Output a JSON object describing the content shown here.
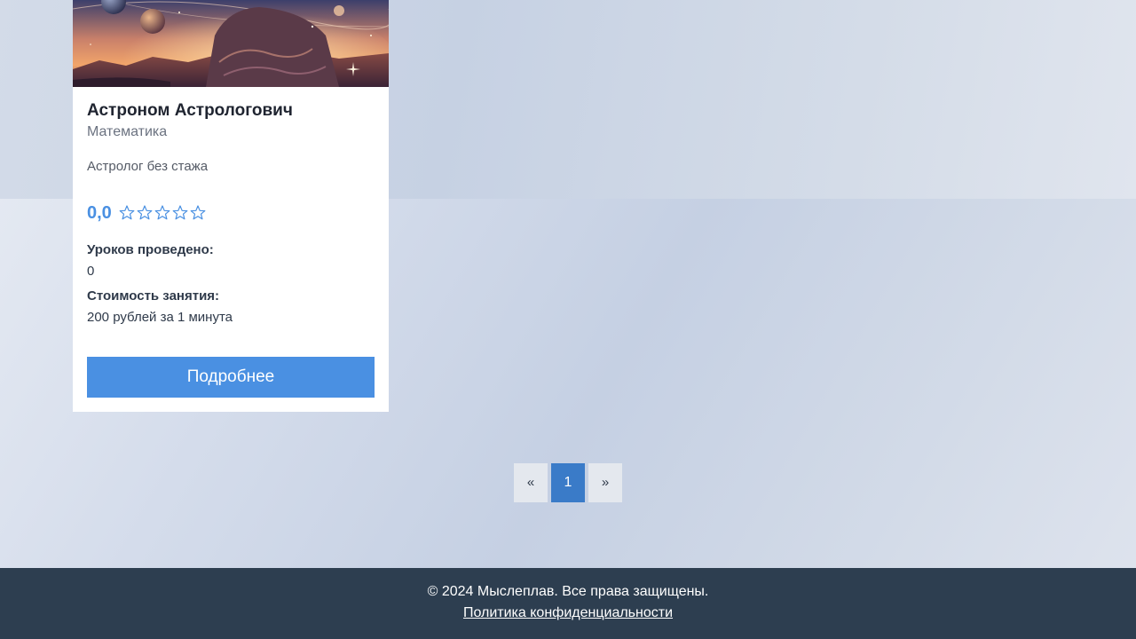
{
  "colors": {
    "accent": "#4a90e2",
    "pagination_active": "#3a7bc8",
    "footer_bg": "#2d3e50"
  },
  "tutor_card": {
    "image_icon": "cosmic-illustration",
    "name": "Астроном Астрологович",
    "subject": "Математика",
    "description": "Астролог без стажа",
    "rating": {
      "value": "0,0",
      "stars_filled": 0,
      "stars_total": 5
    },
    "lessons_label": "Уроков проведено:",
    "lessons_value": "0",
    "price_label": "Стоимость занятия:",
    "price_value": "200 рублей за 1 минута",
    "details_button": "Подробнее"
  },
  "pagination": {
    "prev": "«",
    "current": "1",
    "next": "»"
  },
  "footer": {
    "copyright": "© 2024 Мыслеплав. Все права защищены.",
    "privacy_link": "Политика конфиденциальности"
  }
}
